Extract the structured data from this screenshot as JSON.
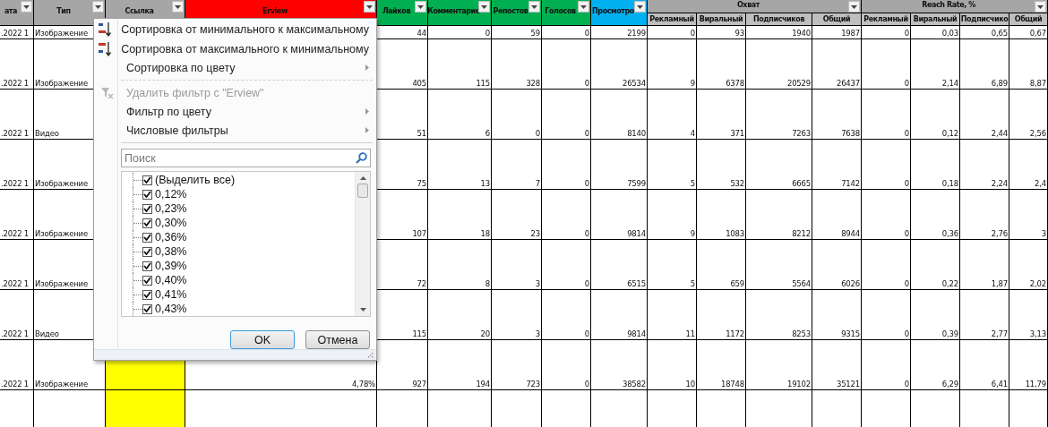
{
  "table": {
    "columns": [
      {
        "label": "ата",
        "color": "#a6a6a6"
      },
      {
        "label": "Тип",
        "color": "#a6a6a6"
      },
      {
        "label": "Ссылка",
        "color": "#a6a6a6",
        "cells": {
          "color": "#ffff00"
        }
      },
      {
        "label": "Erview",
        "color": "#ff0000"
      },
      {
        "label": "Лайков",
        "color": "#00b050"
      },
      {
        "label": "Комментарие",
        "color": "#00b050"
      },
      {
        "label": "Репостов",
        "color": "#00b050"
      },
      {
        "label": "Голосов",
        "color": "#00b050"
      },
      {
        "label": "Просмотро",
        "color": "#00b0f0"
      },
      {
        "label": "Охват",
        "color": "#a6a6a6",
        "children": [
          {
            "label": "Рекламный"
          },
          {
            "label": "Виральный"
          },
          {
            "label": "Подписчиков"
          },
          {
            "label": "Общий"
          }
        ]
      },
      {
        "label": "Reach Rate, %",
        "color": "#a6a6a6",
        "children": [
          {
            "label": "Рекламный"
          },
          {
            "label": "Виральный"
          },
          {
            "label": "Подписчико"
          },
          {
            "label": "Общий"
          }
        ]
      }
    ],
    "rows": [
      {
        "date": ".2022 1",
        "type": "Изображение",
        "values": [
          "44",
          "0",
          "59",
          "0",
          "2199",
          "0",
          "93",
          "1940",
          "1987",
          "0",
          "0,03",
          "0,65",
          "0,67"
        ]
      },
      {
        "date": ".2022 1",
        "type": "Изображение",
        "values": [
          "405",
          "115",
          "328",
          "0",
          "26534",
          "9",
          "6378",
          "20529",
          "26437",
          "0",
          "2,14",
          "6,89",
          "8,87"
        ]
      },
      {
        "date": ".2022 1",
        "type": "Видео",
        "values": [
          "51",
          "6",
          "0",
          "0",
          "8140",
          "4",
          "371",
          "7263",
          "7638",
          "0",
          "0,12",
          "2,44",
          "2,56"
        ]
      },
      {
        "date": ".2022 1",
        "type": "Изображение",
        "values": [
          "75",
          "13",
          "7",
          "0",
          "7599",
          "5",
          "532",
          "6665",
          "7142",
          "0",
          "0,18",
          "2,24",
          "2,4"
        ]
      },
      {
        "date": ".2022 1",
        "type": "Изображение",
        "values": [
          "107",
          "18",
          "23",
          "0",
          "9814",
          "9",
          "1083",
          "8212",
          "8944",
          "0",
          "0,36",
          "2,76",
          "3"
        ]
      },
      {
        "date": ".2022 1",
        "type": "Изображение",
        "values": [
          "72",
          "8",
          "3",
          "0",
          "6515",
          "5",
          "659",
          "5564",
          "6026",
          "0",
          "0,22",
          "1,87",
          "2,02"
        ]
      },
      {
        "date": ".2022 1",
        "type": "Видео",
        "values": [
          "115",
          "20",
          "3",
          "0",
          "9814",
          "11",
          "1172",
          "8253",
          "9315",
          "0",
          "0,39",
          "2,77",
          "3,13"
        ]
      },
      {
        "date": ".2022 1",
        "type": "Изображение",
        "erview": "4,78%",
        "values": [
          "927",
          "194",
          "723",
          "0",
          "38582",
          "10",
          "18748",
          "19102",
          "35121",
          "0",
          "6,29",
          "6,41",
          "11,79"
        ]
      }
    ]
  },
  "filter_menu": {
    "items": [
      {
        "kind": "sort-asc",
        "label": "Сортировка от минимального к максимальному",
        "disabled": false,
        "submenu": false
      },
      {
        "kind": "sort-desc",
        "label": "Сортировка от максимального к минимальному",
        "disabled": false,
        "submenu": false
      },
      {
        "kind": "text",
        "label": "Сортировка по цвету",
        "disabled": false,
        "submenu": true
      },
      {
        "kind": "separator"
      },
      {
        "kind": "clear-filter",
        "label": "Удалить фильтр с \"Erview\"",
        "disabled": true,
        "submenu": false
      },
      {
        "kind": "text",
        "label": "Фильтр по цвету",
        "disabled": false,
        "submenu": true
      },
      {
        "kind": "text",
        "label": "Числовые фильтры",
        "disabled": false,
        "submenu": true
      },
      {
        "kind": "separator"
      }
    ],
    "search": {
      "placeholder": "Поиск"
    },
    "values": [
      {
        "label": "(Выделить все)",
        "checked": true
      },
      {
        "label": "0,12%",
        "checked": true
      },
      {
        "label": "0,23%",
        "checked": true
      },
      {
        "label": "0,30%",
        "checked": true
      },
      {
        "label": "0,36%",
        "checked": true
      },
      {
        "label": "0,38%",
        "checked": true
      },
      {
        "label": "0,39%",
        "checked": true
      },
      {
        "label": "0,40%",
        "checked": true
      },
      {
        "label": "0,41%",
        "checked": true
      },
      {
        "label": "0,43%",
        "checked": true
      }
    ],
    "buttons": [
      {
        "label": "OK",
        "default": true
      },
      {
        "label": "Отмена",
        "default": false
      }
    ]
  }
}
